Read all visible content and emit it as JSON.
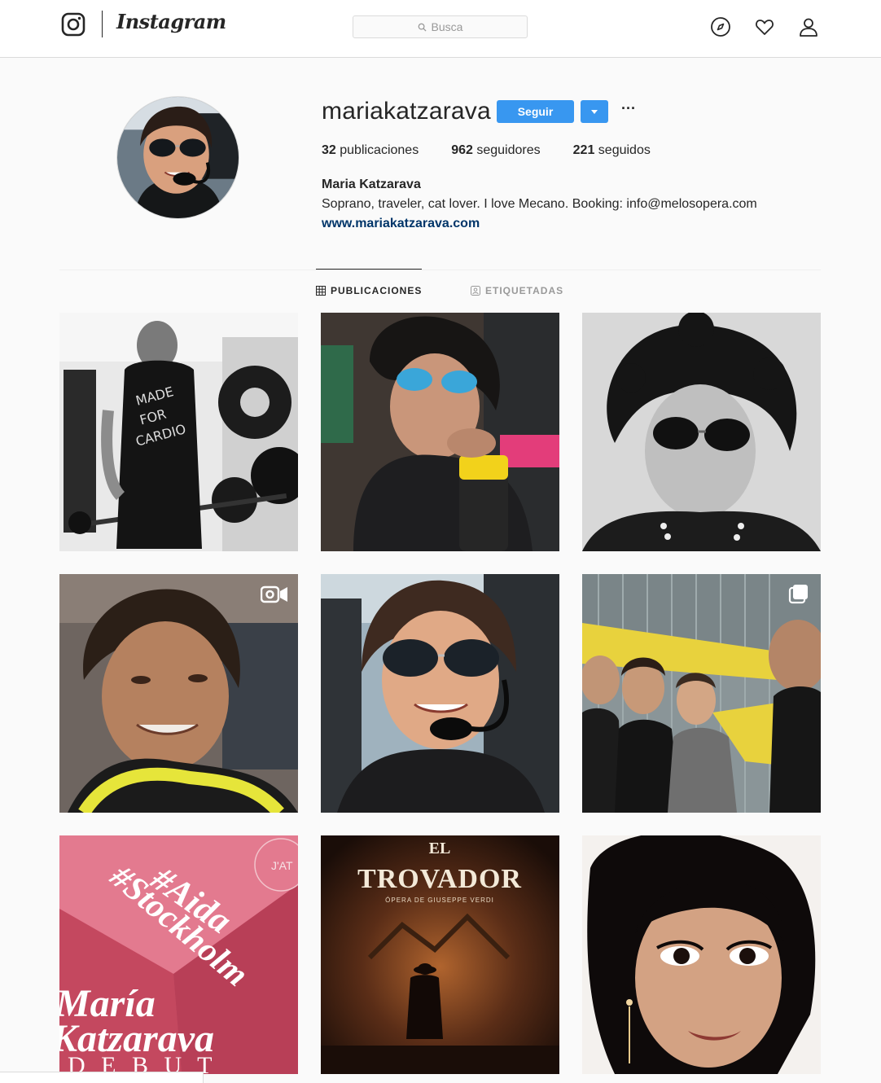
{
  "header": {
    "wordmark": "Instagram",
    "search_placeholder": "Busca",
    "icons": [
      "instagram-camera-icon",
      "search-icon",
      "compass-icon",
      "heart-icon",
      "profile-icon"
    ]
  },
  "profile": {
    "username": "mariakatzarava",
    "follow_label": "Seguir",
    "more_label": "···",
    "stats": [
      {
        "count": "32",
        "label": "publicaciones"
      },
      {
        "count": "962",
        "label": "seguidores"
      },
      {
        "count": "221",
        "label": "seguidos"
      }
    ],
    "full_name": "Maria Katzarava",
    "bio": "Soprano, traveler, cat lover. I love Mecano. Booking: info@melosopera.com",
    "website": "www.mariakatzarava.com"
  },
  "tabs": [
    {
      "label": "PUBLICACIONES",
      "active": true
    },
    {
      "label": "ETIQUETADAS",
      "active": false
    }
  ],
  "posts": {
    "tile7": {
      "tag1": "#Aida",
      "tag2": "#Stockholm",
      "name1": "María",
      "name2": "Katzarava",
      "debut": "D E B U T",
      "corner": "J'AT"
    },
    "tile8": {
      "el": "EL",
      "title": "TROVADOR",
      "subtitle": "ÓPERA DE GIUSEPPE VERDI"
    }
  },
  "colors": {
    "accent": "#3897f0",
    "link": "#003569",
    "border": "#dbdbdb"
  }
}
